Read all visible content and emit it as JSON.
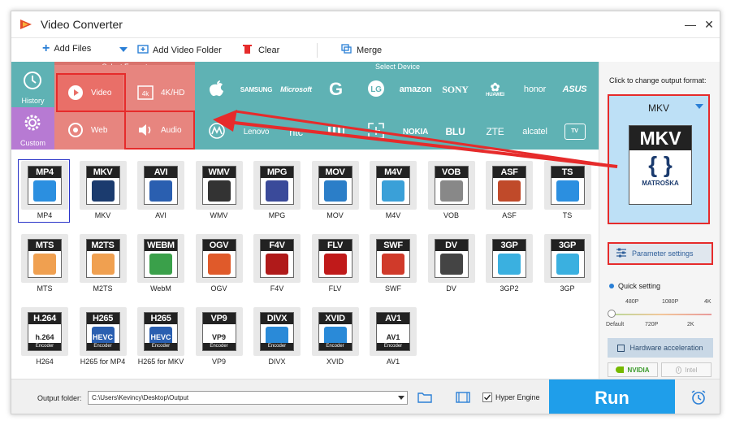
{
  "titlebar": {
    "title": "Video Converter",
    "minimize": "—",
    "close": "✕"
  },
  "toolbar": {
    "add_files": "Add Files",
    "add_folder": "Add Video Folder",
    "clear": "Clear",
    "merge": "Merge"
  },
  "categories": {
    "select_format": "Select Format",
    "select_device": "Select Device",
    "history": "History",
    "custom": "Custom",
    "video": "Video",
    "hd": "4K/HD",
    "web": "Web",
    "audio": "Audio"
  },
  "devices": {
    "row1": [
      "apple-icon",
      "SAMSUNG",
      "Microsoft",
      "google-icon",
      "lg-icon",
      "amazon",
      "SONY",
      "HUAWEI",
      "honor",
      "ASUS"
    ],
    "row2": [
      "motorola-icon",
      "Lenovo",
      "htc",
      "blackberry-icon",
      "nokia-device-icon",
      "NOKIA",
      "BLU",
      "ZTE",
      "alcatel",
      "TV"
    ]
  },
  "formats": [
    {
      "badge": "MP4",
      "name": "MP4",
      "img": "#2b8fe0"
    },
    {
      "badge": "MKV",
      "name": "MKV",
      "img": "#1b3b6e"
    },
    {
      "badge": "AVI",
      "name": "AVI",
      "img": "#2a5fb0"
    },
    {
      "badge": "WMV",
      "name": "WMV",
      "img": "#333333"
    },
    {
      "badge": "MPG",
      "name": "MPG",
      "img": "#3a4a9a"
    },
    {
      "badge": "MOV",
      "name": "MOV",
      "img": "#2b7ec8"
    },
    {
      "badge": "M4V",
      "name": "M4V",
      "img": "#3aa0d8"
    },
    {
      "badge": "VOB",
      "name": "VOB",
      "img": "#888888"
    },
    {
      "badge": "ASF",
      "name": "ASF",
      "img": "#c04a2a"
    },
    {
      "badge": "TS",
      "name": "TS",
      "img": "#2b8fe0"
    },
    {
      "badge": "MTS",
      "name": "MTS",
      "img": "#f0a050"
    },
    {
      "badge": "M2TS",
      "name": "M2TS",
      "img": "#f0a050"
    },
    {
      "badge": "WEBM",
      "name": "WebM",
      "img": "#3aa04a"
    },
    {
      "badge": "OGV",
      "name": "OGV",
      "img": "#e05a2a"
    },
    {
      "badge": "F4V",
      "name": "F4V",
      "img": "#b01a1a"
    },
    {
      "badge": "FLV",
      "name": "FLV",
      "img": "#c01a1a"
    },
    {
      "badge": "SWF",
      "name": "SWF",
      "img": "#d03a2a"
    },
    {
      "badge": "DV",
      "name": "DV",
      "img": "#444444"
    },
    {
      "badge": "3GP",
      "name": "3GP2",
      "img": "#3ab0e0"
    },
    {
      "badge": "3GP",
      "name": "3GP",
      "img": "#3ab0e0"
    },
    {
      "badge": "H.264",
      "name": "H264",
      "img": "#ffffff",
      "enc": "Encoder",
      "text": "h.264"
    },
    {
      "badge": "H265",
      "name": "H265 for MP4",
      "img": "#2a5fb0",
      "enc": "Encoder",
      "text": "HEVC"
    },
    {
      "badge": "H265",
      "name": "H265 for MKV",
      "img": "#2a5fb0",
      "enc": "Encoder",
      "text": "HEVC"
    },
    {
      "badge": "VP9",
      "name": "VP9",
      "img": "#ffffff",
      "enc": "Encoder",
      "text": "VP9"
    },
    {
      "badge": "DIVX",
      "name": "DIVX",
      "img": "#2a8ad8",
      "enc": "Encoder"
    },
    {
      "badge": "XVID",
      "name": "XVID",
      "img": "#2a8ad8",
      "enc": "Encoder"
    },
    {
      "badge": "AV1",
      "name": "AV1",
      "img": "#ffffff",
      "enc": "Encoder",
      "text": "AV1"
    }
  ],
  "right_panel": {
    "hint": "Click to change output format:",
    "output_format": "MKV",
    "badge_text": "MKV",
    "badge_brand": "MATROŠKA",
    "param_settings": "Parameter settings",
    "quick_setting": "Quick setting",
    "top_labels": [
      "480P",
      "1080P",
      "4K"
    ],
    "bottom_labels": [
      "Default",
      "720P",
      "2K"
    ],
    "hw_accel": "Hardware acceleration",
    "nvidia": "NVIDIA",
    "intel": "Intel"
  },
  "bottom": {
    "output_label": "Output folder:",
    "output_path": "C:\\Users\\Kevincy\\Desktop\\Output",
    "hyper_engine": "Hyper Engine",
    "run": "Run"
  },
  "colors": {
    "teal": "#5fb2b4",
    "salmon": "#e7857f",
    "highlight": "#e62b2b",
    "run": "#1f9eea",
    "output_bg": "#bde0f6"
  }
}
